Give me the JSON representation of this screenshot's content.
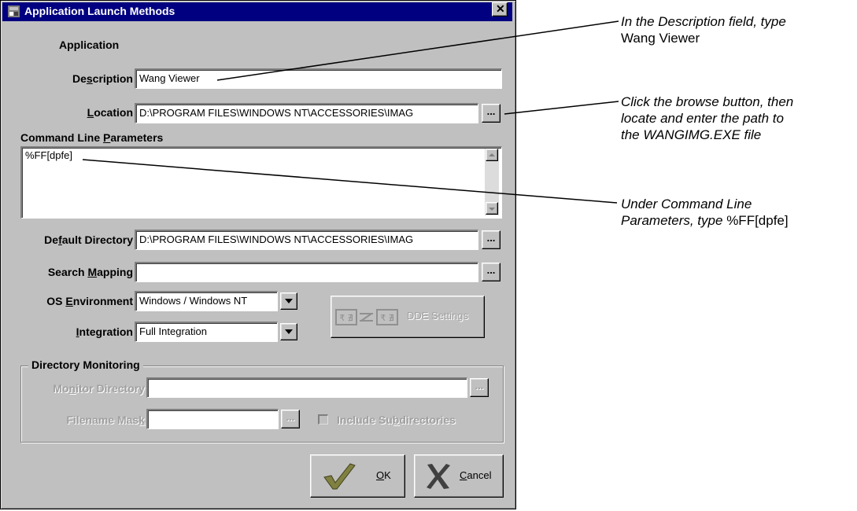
{
  "window": {
    "title": "Application Launch Methods",
    "close_glyph": "✕"
  },
  "form": {
    "section_label": "Application",
    "description": {
      "label": "Description",
      "value": "Wang Viewer"
    },
    "location": {
      "label": "Location",
      "value": "D:\\PROGRAM FILES\\WINDOWS NT\\ACCESSORIES\\IMAG",
      "browse": "..."
    },
    "command_line": {
      "label": "Command Line Parameters",
      "value": "%FF[dpfe]"
    },
    "default_directory": {
      "label": "Default Directory",
      "value": "D:\\PROGRAM FILES\\WINDOWS NT\\ACCESSORIES\\IMAG",
      "browse": "..."
    },
    "search_mapping": {
      "label": "Search Mapping",
      "value": "",
      "browse": "..."
    },
    "os_environment": {
      "label": "OS Environment",
      "value": "Windows / Windows NT"
    },
    "integration": {
      "label": "Integration",
      "value": "Full Integration"
    },
    "dde_settings": {
      "label": "DDE Settings"
    }
  },
  "directory_monitoring": {
    "title": "Directory Monitoring",
    "monitor_directory": {
      "label": "Monitor Directory",
      "value": "",
      "browse": "..."
    },
    "filename_mask": {
      "label": "Filename Mask",
      "value": "",
      "browse": "..."
    },
    "include_subdirectories": {
      "label": "Include Subdirectories",
      "checked": false
    }
  },
  "buttons": {
    "ok": "OK",
    "cancel": "Cancel"
  },
  "annotations": {
    "description": {
      "italic": "In the Description field, type",
      "plain": "Wang Viewer"
    },
    "location": {
      "line1": "Click the browse button, then",
      "line2": "locate and enter the path to",
      "line3": "the WANGIMG.EXE file"
    },
    "command_line": {
      "line1": "Under Command Line",
      "italic": "Parameters, type",
      "plain": "%FF[dpfe]"
    }
  },
  "colors": {
    "titlebar": "#000080",
    "dialog_face": "#c0c0c0",
    "ok_check": "#808040",
    "cancel_x": "#404040"
  },
  "icons": [
    "app-icon",
    "close-icon",
    "scroll-up-icon",
    "scroll-down-icon",
    "dropdown-arrow-icon",
    "dde-link-icon",
    "checkmark-icon",
    "cancel-x-icon"
  ]
}
